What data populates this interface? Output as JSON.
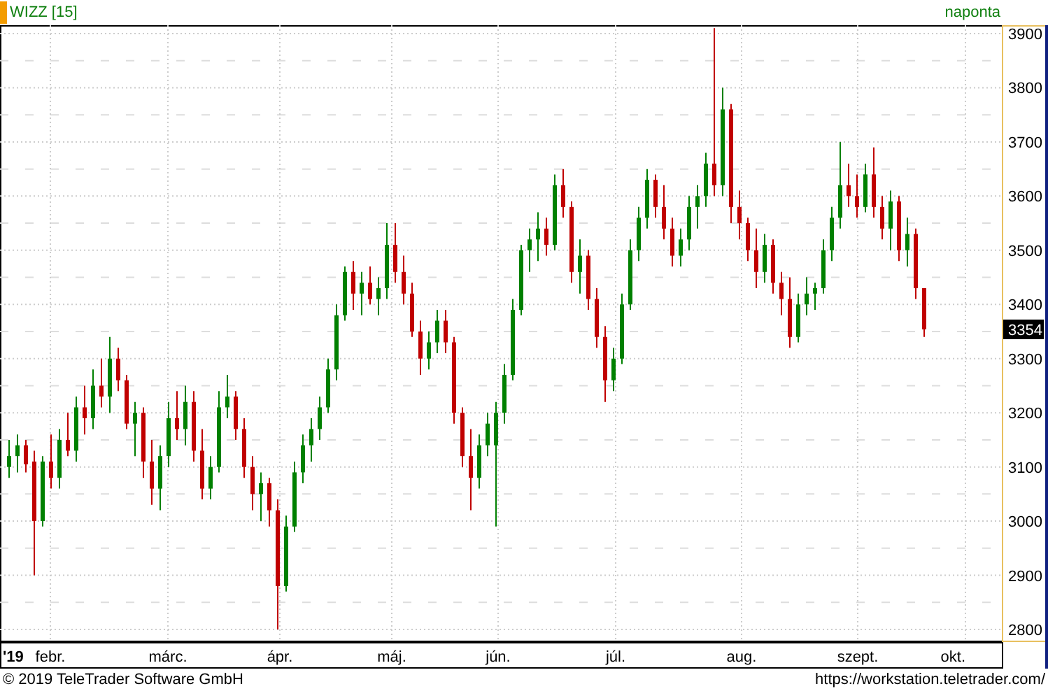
{
  "header": {
    "symbol": "WIZZ [15]",
    "interval": "naponta"
  },
  "chart": {
    "chart_data": {
      "type": "candlestick",
      "categories": [
        null,
        null,
        null,
        null,
        null,
        null,
        null,
        null,
        null,
        null,
        null,
        null,
        null,
        null,
        null,
        null,
        null,
        null,
        null,
        null,
        null,
        null,
        null,
        null,
        null,
        null,
        null,
        null,
        null,
        null,
        null,
        null,
        null,
        null,
        null,
        null,
        null,
        null,
        null,
        null,
        null,
        null,
        null,
        null,
        null,
        null,
        null,
        null,
        null,
        null,
        null,
        null,
        null,
        null,
        null,
        null,
        null,
        null,
        null,
        null,
        null,
        null,
        null,
        null,
        null,
        null,
        null,
        null,
        null,
        null,
        null,
        null,
        null,
        null,
        null,
        null,
        null,
        null,
        null,
        null,
        null,
        null,
        null,
        null,
        null,
        null,
        null,
        null,
        null,
        null,
        null,
        null,
        null,
        null,
        null,
        null,
        null,
        null,
        null,
        null,
        null,
        null,
        null,
        null,
        null,
        null,
        null,
        null,
        null,
        null
      ],
      "ohlc": [
        [
          3100,
          3150,
          3080,
          3120
        ],
        [
          3120,
          3160,
          3090,
          3140
        ],
        [
          3140,
          3150,
          3090,
          3105
        ],
        [
          3110,
          3130,
          2900,
          3000
        ],
        [
          3000,
          3120,
          2990,
          3110
        ],
        [
          3110,
          3160,
          3060,
          3080
        ],
        [
          3080,
          3170,
          3060,
          3150
        ],
        [
          3150,
          3200,
          3120,
          3130
        ],
        [
          3130,
          3230,
          3110,
          3210
        ],
        [
          3210,
          3250,
          3160,
          3190
        ],
        [
          3190,
          3280,
          3170,
          3250
        ],
        [
          3250,
          3300,
          3210,
          3230
        ],
        [
          3230,
          3340,
          3200,
          3300
        ],
        [
          3300,
          3320,
          3240,
          3260
        ],
        [
          3260,
          3270,
          3170,
          3180
        ],
        [
          3180,
          3220,
          3120,
          3200
        ],
        [
          3200,
          3210,
          3080,
          3110
        ],
        [
          3110,
          3150,
          3030,
          3060
        ],
        [
          3060,
          3140,
          3020,
          3120
        ],
        [
          3120,
          3220,
          3100,
          3190
        ],
        [
          3190,
          3240,
          3150,
          3170
        ],
        [
          3170,
          3250,
          3140,
          3220
        ],
        [
          3220,
          3240,
          3110,
          3130
        ],
        [
          3130,
          3170,
          3040,
          3060
        ],
        [
          3060,
          3120,
          3040,
          3100
        ],
        [
          3100,
          3240,
          3090,
          3210
        ],
        [
          3210,
          3270,
          3190,
          3230
        ],
        [
          3230,
          3240,
          3150,
          3170
        ],
        [
          3170,
          3190,
          3080,
          3100
        ],
        [
          3100,
          3120,
          3020,
          3050
        ],
        [
          3050,
          3090,
          3000,
          3070
        ],
        [
          3070,
          3080,
          2990,
          3020
        ],
        [
          3020,
          3040,
          2800,
          2880
        ],
        [
          2880,
          3010,
          2870,
          2990
        ],
        [
          2990,
          3110,
          2980,
          3090
        ],
        [
          3090,
          3160,
          3070,
          3140
        ],
        [
          3140,
          3190,
          3110,
          3170
        ],
        [
          3170,
          3230,
          3150,
          3210
        ],
        [
          3210,
          3300,
          3200,
          3280
        ],
        [
          3280,
          3400,
          3260,
          3380
        ],
        [
          3380,
          3470,
          3370,
          3460
        ],
        [
          3460,
          3480,
          3390,
          3420
        ],
        [
          3420,
          3460,
          3380,
          3440
        ],
        [
          3440,
          3470,
          3400,
          3410
        ],
        [
          3410,
          3450,
          3380,
          3430
        ],
        [
          3430,
          3550,
          3410,
          3510
        ],
        [
          3510,
          3550,
          3440,
          3460
        ],
        [
          3460,
          3490,
          3400,
          3420
        ],
        [
          3420,
          3440,
          3340,
          3350
        ],
        [
          3350,
          3370,
          3270,
          3300
        ],
        [
          3300,
          3350,
          3280,
          3330
        ],
        [
          3330,
          3390,
          3310,
          3370
        ],
        [
          3370,
          3390,
          3310,
          3330
        ],
        [
          3330,
          3340,
          3180,
          3200
        ],
        [
          3200,
          3210,
          3100,
          3120
        ],
        [
          3120,
          3170,
          3020,
          3080
        ],
        [
          3080,
          3160,
          3060,
          3140
        ],
        [
          3140,
          3200,
          3120,
          3180
        ],
        [
          3140,
          3220,
          2990,
          3200
        ],
        [
          3200,
          3290,
          3180,
          3270
        ],
        [
          3270,
          3410,
          3260,
          3390
        ],
        [
          3390,
          3510,
          3380,
          3500
        ],
        [
          3500,
          3540,
          3460,
          3520
        ],
        [
          3520,
          3570,
          3480,
          3540
        ],
        [
          3540,
          3560,
          3490,
          3510
        ],
        [
          3510,
          3640,
          3500,
          3620
        ],
        [
          3620,
          3650,
          3560,
          3580
        ],
        [
          3580,
          3590,
          3440,
          3460
        ],
        [
          3460,
          3520,
          3420,
          3490
        ],
        [
          3490,
          3500,
          3390,
          3410
        ],
        [
          3410,
          3430,
          3320,
          3340
        ],
        [
          3340,
          3360,
          3220,
          3260
        ],
        [
          3260,
          3320,
          3240,
          3300
        ],
        [
          3300,
          3420,
          3290,
          3400
        ],
        [
          3400,
          3520,
          3390,
          3500
        ],
        [
          3500,
          3580,
          3480,
          3560
        ],
        [
          3560,
          3650,
          3540,
          3630
        ],
        [
          3630,
          3640,
          3560,
          3580
        ],
        [
          3580,
          3620,
          3520,
          3540
        ],
        [
          3540,
          3560,
          3470,
          3490
        ],
        [
          3490,
          3540,
          3470,
          3520
        ],
        [
          3520,
          3600,
          3500,
          3580
        ],
        [
          3580,
          3620,
          3540,
          3600
        ],
        [
          3600,
          3680,
          3580,
          3660
        ],
        [
          3660,
          3910,
          3600,
          3620
        ],
        [
          3620,
          3800,
          3600,
          3760
        ],
        [
          3760,
          3770,
          3550,
          3580
        ],
        [
          3580,
          3610,
          3520,
          3550
        ],
        [
          3550,
          3560,
          3480,
          3500
        ],
        [
          3500,
          3540,
          3430,
          3460
        ],
        [
          3460,
          3530,
          3440,
          3510
        ],
        [
          3510,
          3520,
          3420,
          3440
        ],
        [
          3440,
          3460,
          3380,
          3410
        ],
        [
          3410,
          3450,
          3320,
          3340
        ],
        [
          3340,
          3420,
          3330,
          3400
        ],
        [
          3400,
          3450,
          3380,
          3420
        ],
        [
          3420,
          3440,
          3390,
          3430
        ],
        [
          3430,
          3520,
          3420,
          3500
        ],
        [
          3500,
          3580,
          3480,
          3560
        ],
        [
          3560,
          3700,
          3540,
          3620
        ],
        [
          3620,
          3660,
          3580,
          3600
        ],
        [
          3600,
          3640,
          3560,
          3580
        ],
        [
          3580,
          3660,
          3570,
          3640
        ],
        [
          3640,
          3690,
          3560,
          3580
        ],
        [
          3580,
          3600,
          3520,
          3540
        ],
        [
          3540,
          3610,
          3500,
          3590
        ],
        [
          3590,
          3600,
          3480,
          3500
        ],
        [
          3500,
          3560,
          3470,
          3530
        ],
        [
          3530,
          3540,
          3410,
          3430
        ],
        [
          3430,
          3430,
          3340,
          3354
        ]
      ],
      "ylim": [
        2780,
        3920
      ],
      "grid": true,
      "yticks": [
        3900,
        3800,
        3700,
        3600,
        3500,
        3400,
        3300,
        3200,
        3100,
        3000,
        2900,
        2800
      ]
    }
  },
  "y_axis": {
    "last_price": "3354"
  },
  "x_axis": {
    "year": "'19",
    "months": [
      "febr.",
      "márc.",
      "ápr.",
      "máj.",
      "jún.",
      "júl.",
      "aug.",
      "szept.",
      "okt."
    ]
  },
  "footer": {
    "copyright": "© 2019 TeleTrader Software GmbH",
    "url": "https://workstation.teletrader.com/"
  }
}
